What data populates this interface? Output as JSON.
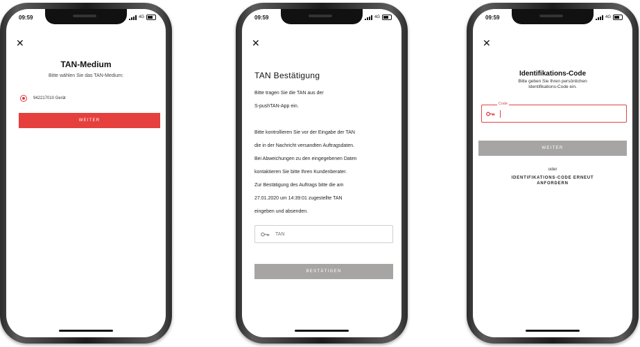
{
  "status_bar": {
    "time": "09:59",
    "network": "4G"
  },
  "screen1": {
    "title": "TAN-Medium",
    "subtitle": "Bitte wählen Sie das TAN-Medium:",
    "option_label": "942217010 Gerät",
    "button_label": "WEITER"
  },
  "screen2": {
    "title": "TAN Bestätigung",
    "intro_lines": [
      "Bitte tragen Sie die TAN aus der",
      "S-pushTAN-App ein."
    ],
    "info_lines": [
      "Bitte kontrollieren Sie vor der Eingabe der TAN",
      "die in der Nachricht versandten Auftragsdaten.",
      "Bei Abweichungen zu den eingegebenen Daten",
      "kontaktieren Sie bitte Ihren Kundenberater.",
      "Zur Bestätigung des Auftrags bitte die am",
      "27.01.2020 um 14:39:01 zugestellte TAN",
      "eingeben und absenden."
    ],
    "input_placeholder": "TAN",
    "button_label": "BESTÄTIGEN"
  },
  "screen3": {
    "title": "Identifikations-Code",
    "subtitle_lines": [
      "Bitte geben Sie Ihren persönlichen",
      "Identifikations-Code ein."
    ],
    "field_label": "Code",
    "button_label": "WEITER",
    "or_text": "oder",
    "link_lines": [
      "IDENTIFIKATIONS-CODE ERNEUT",
      "ANFORDERN"
    ]
  },
  "colors": {
    "accent_red": "#e5403e",
    "button_grey": "#a7a5a3"
  },
  "icons": {
    "close": "close-icon",
    "key": "key-icon",
    "radio": "radio-selected-icon"
  }
}
